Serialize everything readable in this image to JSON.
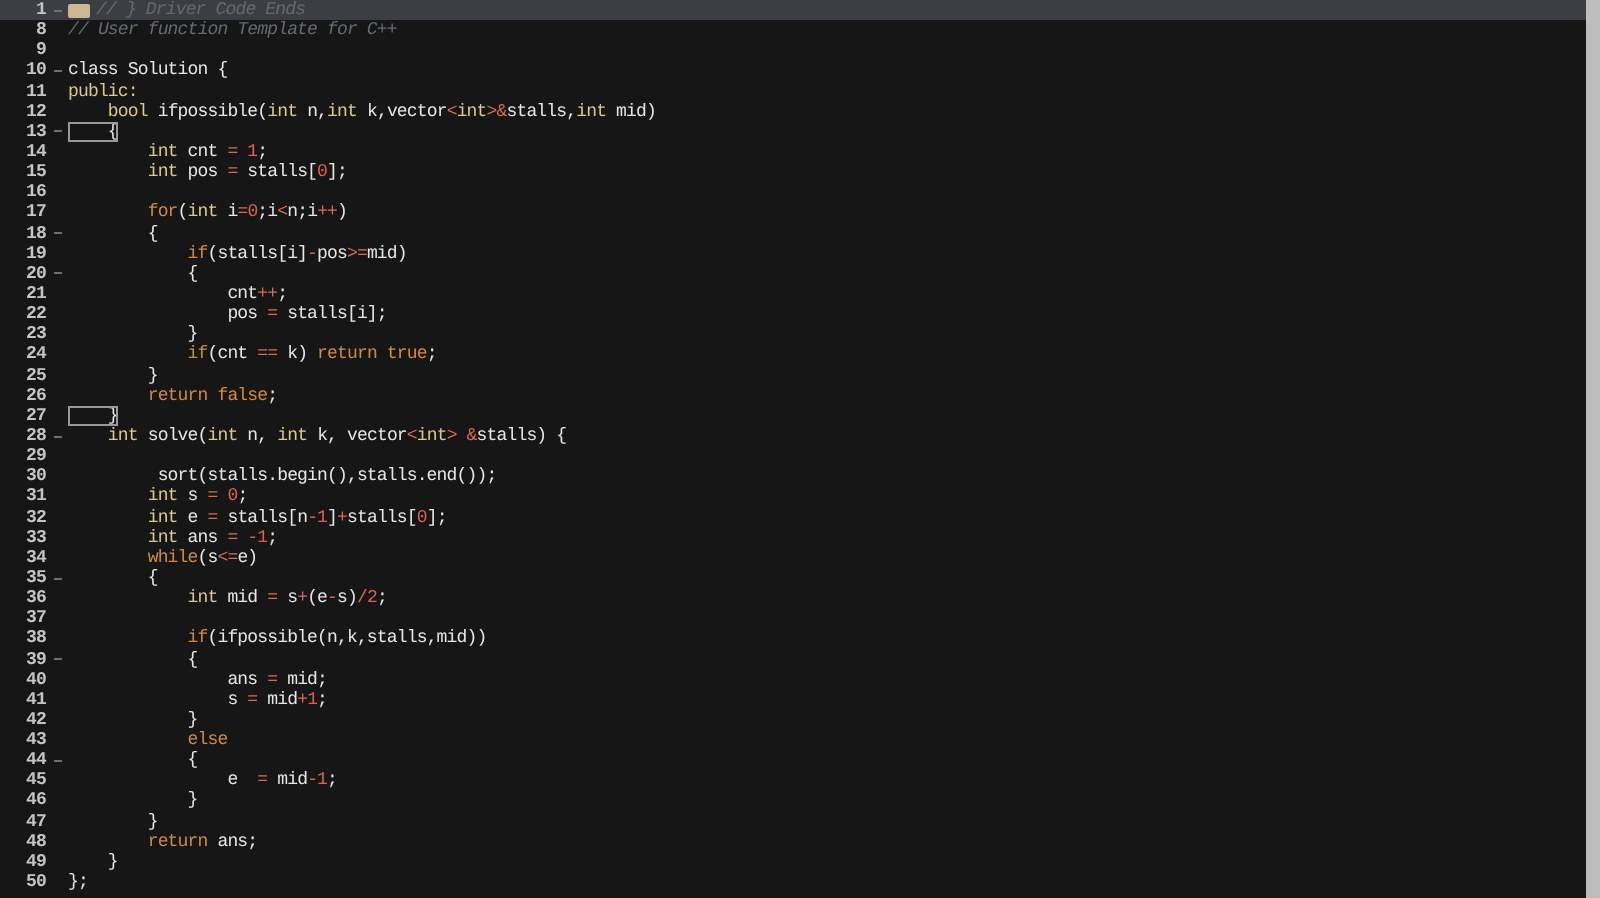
{
  "editor": {
    "lines": [
      {
        "number": "1",
        "foldable": true,
        "folded": true,
        "tokens": [
          {
            "kind": "comment",
            "text": "// } Driver Code Ends"
          }
        ]
      },
      {
        "number": "8",
        "foldable": false,
        "folded": false,
        "tokens": [
          {
            "kind": "comment",
            "text": "// User function Template for C++"
          }
        ]
      },
      {
        "number": "9",
        "foldable": false,
        "folded": false
      },
      {
        "number": "10",
        "foldable": true,
        "folded": false,
        "tokens": [
          {
            "kind": "plain",
            "text": "class Solution {"
          }
        ]
      },
      {
        "number": "11",
        "foldable": false,
        "folded": false,
        "tokens": [
          {
            "kind": "type",
            "text": "public:"
          }
        ]
      },
      {
        "number": "12",
        "foldable": false,
        "folded": false,
        "tokens": [
          {
            "kind": "type",
            "text": "    bool"
          },
          {
            "kind": "plain",
            "text": " ifpossible("
          },
          {
            "kind": "type",
            "text": "int"
          },
          {
            "kind": "plain",
            "text": " n,"
          },
          {
            "kind": "type",
            "text": "int"
          },
          {
            "kind": "plain",
            "text": " k,vector"
          },
          {
            "kind": "operator",
            "text": "<"
          },
          {
            "kind": "type",
            "text": "int"
          },
          {
            "kind": "operator",
            "text": ">&"
          },
          {
            "kind": "plain",
            "text": "stalls,"
          },
          {
            "kind": "type",
            "text": "int"
          },
          {
            "kind": "plain",
            "text": " mid)"
          }
        ]
      },
      {
        "number": "13",
        "foldable": true,
        "folded": false,
        "tokens": [
          {
            "kind": "bracket",
            "text": "    {"
          }
        ]
      },
      {
        "number": "14",
        "foldable": false,
        "folded": false,
        "tokens": [
          {
            "kind": "type",
            "text": "        int"
          },
          {
            "kind": "plain",
            "text": " cnt "
          },
          {
            "kind": "operator",
            "text": "="
          },
          {
            "kind": "number",
            "text": " 1"
          },
          {
            "kind": "plain",
            "text": ";"
          }
        ]
      },
      {
        "number": "15",
        "foldable": false,
        "folded": false,
        "tokens": [
          {
            "kind": "type",
            "text": "        int"
          },
          {
            "kind": "plain",
            "text": " pos "
          },
          {
            "kind": "operator",
            "text": "="
          },
          {
            "kind": "plain",
            "text": " stalls["
          },
          {
            "kind": "number",
            "text": "0"
          },
          {
            "kind": "plain",
            "text": "];"
          }
        ]
      },
      {
        "number": "16",
        "foldable": false,
        "folded": false
      },
      {
        "number": "17",
        "foldable": false,
        "folded": false,
        "tokens": [
          {
            "kind": "keyword",
            "text": "        for"
          },
          {
            "kind": "plain",
            "text": "("
          },
          {
            "kind": "type",
            "text": "int"
          },
          {
            "kind": "plain",
            "text": " i"
          },
          {
            "kind": "operator",
            "text": "="
          },
          {
            "kind": "number",
            "text": "0"
          },
          {
            "kind": "plain",
            "text": ";i"
          },
          {
            "kind": "operator",
            "text": "<"
          },
          {
            "kind": "plain",
            "text": "n;i"
          },
          {
            "kind": "operator",
            "text": "++"
          },
          {
            "kind": "plain",
            "text": ")"
          }
        ]
      },
      {
        "number": "18",
        "foldable": true,
        "folded": false,
        "tokens": [
          {
            "kind": "plain",
            "text": "        {"
          }
        ]
      },
      {
        "number": "19",
        "foldable": false,
        "folded": false,
        "tokens": [
          {
            "kind": "keyword",
            "text": "            if"
          },
          {
            "kind": "plain",
            "text": "(stalls[i]"
          },
          {
            "kind": "operator",
            "text": "-"
          },
          {
            "kind": "plain",
            "text": "pos"
          },
          {
            "kind": "operator",
            "text": ">="
          },
          {
            "kind": "plain",
            "text": "mid)"
          }
        ]
      },
      {
        "number": "20",
        "foldable": true,
        "folded": false,
        "tokens": [
          {
            "kind": "plain",
            "text": "            {"
          }
        ]
      },
      {
        "number": "21",
        "foldable": false,
        "folded": false,
        "tokens": [
          {
            "kind": "plain",
            "text": "                cnt"
          },
          {
            "kind": "operator",
            "text": "++"
          },
          {
            "kind": "plain",
            "text": ";"
          }
        ]
      },
      {
        "number": "22",
        "foldable": false,
        "folded": false,
        "tokens": [
          {
            "kind": "plain",
            "text": "                pos "
          },
          {
            "kind": "operator",
            "text": "="
          },
          {
            "kind": "plain",
            "text": " stalls[i];"
          }
        ]
      },
      {
        "number": "23",
        "foldable": false,
        "folded": false,
        "tokens": [
          {
            "kind": "plain",
            "text": "            }"
          }
        ]
      },
      {
        "number": "24",
        "foldable": false,
        "folded": false,
        "tokens": [
          {
            "kind": "keyword",
            "text": "            if"
          },
          {
            "kind": "plain",
            "text": "(cnt "
          },
          {
            "kind": "operator",
            "text": "=="
          },
          {
            "kind": "plain",
            "text": " k) "
          },
          {
            "kind": "keyword",
            "text": "return"
          },
          {
            "kind": "literal",
            "text": " true"
          },
          {
            "kind": "plain",
            "text": ";"
          }
        ]
      },
      {
        "number": "25",
        "foldable": false,
        "folded": false,
        "tokens": [
          {
            "kind": "plain",
            "text": "        }"
          }
        ]
      },
      {
        "number": "26",
        "foldable": false,
        "folded": false,
        "tokens": [
          {
            "kind": "keyword",
            "text": "        return"
          },
          {
            "kind": "literal",
            "text": " false"
          },
          {
            "kind": "plain",
            "text": ";"
          }
        ]
      },
      {
        "number": "27",
        "foldable": false,
        "folded": false,
        "tokens": [
          {
            "kind": "bracket",
            "text": "    }"
          }
        ]
      },
      {
        "number": "28",
        "foldable": true,
        "folded": false,
        "tokens": [
          {
            "kind": "type",
            "text": "    int"
          },
          {
            "kind": "plain",
            "text": " solve("
          },
          {
            "kind": "type",
            "text": "int"
          },
          {
            "kind": "plain",
            "text": " n, "
          },
          {
            "kind": "type",
            "text": "int"
          },
          {
            "kind": "plain",
            "text": " k, vector"
          },
          {
            "kind": "operator",
            "text": "<"
          },
          {
            "kind": "type",
            "text": "int"
          },
          {
            "kind": "operator",
            "text": "> &"
          },
          {
            "kind": "plain",
            "text": "stalls) {"
          }
        ]
      },
      {
        "number": "29",
        "foldable": false,
        "folded": false
      },
      {
        "number": "30",
        "foldable": false,
        "folded": false,
        "tokens": [
          {
            "kind": "plain",
            "text": "         sort(stalls.begin(),stalls.end());"
          }
        ]
      },
      {
        "number": "31",
        "foldable": false,
        "folded": false,
        "tokens": [
          {
            "kind": "type",
            "text": "        int"
          },
          {
            "kind": "plain",
            "text": " s "
          },
          {
            "kind": "operator",
            "text": "="
          },
          {
            "kind": "number",
            "text": " 0"
          },
          {
            "kind": "plain",
            "text": ";"
          }
        ]
      },
      {
        "number": "32",
        "foldable": false,
        "folded": false,
        "tokens": [
          {
            "kind": "type",
            "text": "        int"
          },
          {
            "kind": "plain",
            "text": " e "
          },
          {
            "kind": "operator",
            "text": "="
          },
          {
            "kind": "plain",
            "text": " stalls[n"
          },
          {
            "kind": "operator",
            "text": "-"
          },
          {
            "kind": "number",
            "text": "1"
          },
          {
            "kind": "plain",
            "text": "]"
          },
          {
            "kind": "operator",
            "text": "+"
          },
          {
            "kind": "plain",
            "text": "stalls["
          },
          {
            "kind": "number",
            "text": "0"
          },
          {
            "kind": "plain",
            "text": "];"
          }
        ]
      },
      {
        "number": "33",
        "foldable": false,
        "folded": false,
        "tokens": [
          {
            "kind": "type",
            "text": "        int"
          },
          {
            "kind": "plain",
            "text": " ans "
          },
          {
            "kind": "operator",
            "text": "="
          },
          {
            "kind": "number",
            "text": " -1"
          },
          {
            "kind": "plain",
            "text": ";"
          }
        ]
      },
      {
        "number": "34",
        "foldable": false,
        "folded": false,
        "tokens": [
          {
            "kind": "keyword",
            "text": "        while"
          },
          {
            "kind": "plain",
            "text": "(s"
          },
          {
            "kind": "operator",
            "text": "<="
          },
          {
            "kind": "plain",
            "text": "e)"
          }
        ]
      },
      {
        "number": "35",
        "foldable": true,
        "folded": false,
        "tokens": [
          {
            "kind": "plain",
            "text": "        {"
          }
        ]
      },
      {
        "number": "36",
        "foldable": false,
        "folded": false,
        "tokens": [
          {
            "kind": "type",
            "text": "            int"
          },
          {
            "kind": "plain",
            "text": " mid "
          },
          {
            "kind": "operator",
            "text": "="
          },
          {
            "kind": "plain",
            "text": " s"
          },
          {
            "kind": "operator",
            "text": "+"
          },
          {
            "kind": "plain",
            "text": "(e"
          },
          {
            "kind": "operator",
            "text": "-"
          },
          {
            "kind": "plain",
            "text": "s)"
          },
          {
            "kind": "operator",
            "text": "/"
          },
          {
            "kind": "number",
            "text": "2"
          },
          {
            "kind": "plain",
            "text": ";"
          }
        ]
      },
      {
        "number": "37",
        "foldable": false,
        "folded": false
      },
      {
        "number": "38",
        "foldable": false,
        "folded": false,
        "tokens": [
          {
            "kind": "keyword",
            "text": "            if"
          },
          {
            "kind": "plain",
            "text": "(ifpossible(n,k,stalls,mid))"
          }
        ]
      },
      {
        "number": "39",
        "foldable": true,
        "folded": false,
        "tokens": [
          {
            "kind": "plain",
            "text": "            {"
          }
        ]
      },
      {
        "number": "40",
        "foldable": false,
        "folded": false,
        "tokens": [
          {
            "kind": "plain",
            "text": "                ans "
          },
          {
            "kind": "operator",
            "text": "="
          },
          {
            "kind": "plain",
            "text": " mid;"
          }
        ]
      },
      {
        "number": "41",
        "foldable": false,
        "folded": false,
        "tokens": [
          {
            "kind": "plain",
            "text": "                s "
          },
          {
            "kind": "operator",
            "text": "="
          },
          {
            "kind": "plain",
            "text": " mid"
          },
          {
            "kind": "operator",
            "text": "+"
          },
          {
            "kind": "number",
            "text": "1"
          },
          {
            "kind": "plain",
            "text": ";"
          }
        ]
      },
      {
        "number": "42",
        "foldable": false,
        "folded": false,
        "tokens": [
          {
            "kind": "plain",
            "text": "            }"
          }
        ]
      },
      {
        "number": "43",
        "foldable": false,
        "folded": false,
        "tokens": [
          {
            "kind": "keyword",
            "text": "            else"
          }
        ]
      },
      {
        "number": "44",
        "foldable": true,
        "folded": false,
        "tokens": [
          {
            "kind": "plain",
            "text": "            {"
          }
        ]
      },
      {
        "number": "45",
        "foldable": false,
        "folded": false,
        "tokens": [
          {
            "kind": "plain",
            "text": "                e  "
          },
          {
            "kind": "operator",
            "text": "="
          },
          {
            "kind": "plain",
            "text": " mid"
          },
          {
            "kind": "operator",
            "text": "-"
          },
          {
            "kind": "number",
            "text": "1"
          },
          {
            "kind": "plain",
            "text": ";"
          }
        ]
      },
      {
        "number": "46",
        "foldable": false,
        "folded": false,
        "tokens": [
          {
            "kind": "plain",
            "text": "            }"
          }
        ]
      },
      {
        "number": "47",
        "foldable": false,
        "folded": false,
        "tokens": [
          {
            "kind": "plain",
            "text": "        }"
          }
        ]
      },
      {
        "number": "48",
        "foldable": false,
        "folded": false,
        "tokens": [
          {
            "kind": "keyword",
            "text": "        return"
          },
          {
            "kind": "plain",
            "text": " ans;"
          }
        ]
      },
      {
        "number": "49",
        "foldable": false,
        "folded": false,
        "tokens": [
          {
            "kind": "plain",
            "text": "    }"
          }
        ]
      },
      {
        "number": "50",
        "foldable": false,
        "folded": false,
        "tokens": [
          {
            "kind": "plain",
            "text": "};"
          }
        ]
      }
    ]
  }
}
